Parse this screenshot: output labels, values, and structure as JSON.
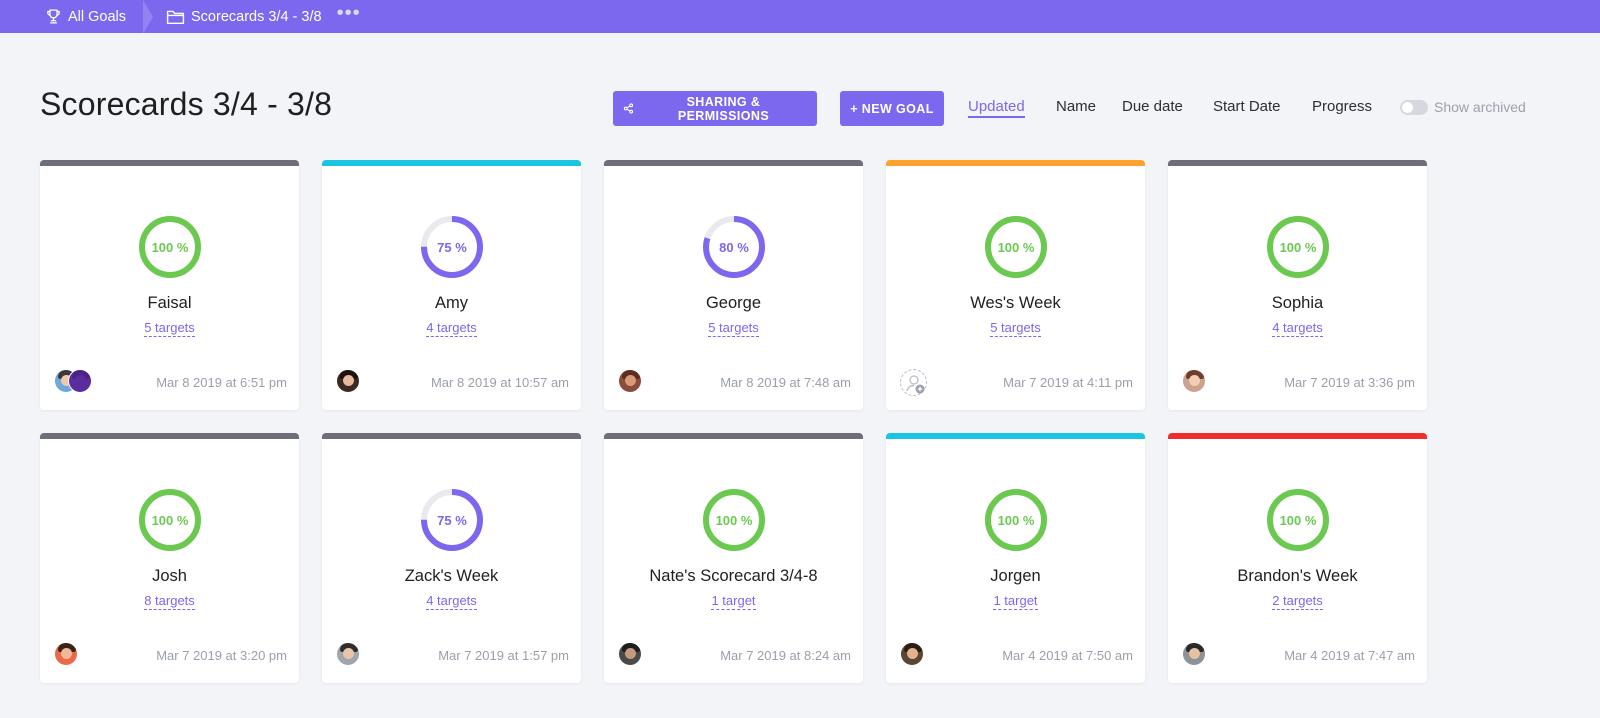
{
  "breadcrumb": {
    "all_goals": "All Goals",
    "folder": "Scorecards 3/4 - 3/8",
    "more": "•••"
  },
  "header": {
    "title": "Scorecards 3/4 - 3/8",
    "share_button": "SHARING & PERMISSIONS",
    "new_goal_button": "+ NEW GOAL",
    "sort_options": [
      "Updated",
      "Name",
      "Due date",
      "Start Date",
      "Progress"
    ],
    "active_sort": "Updated",
    "show_archived_label": "Show archived",
    "show_archived": false
  },
  "colors": {
    "brand": "#7b68ee",
    "complete": "#6bc950",
    "ring_track": "#e8eaed",
    "strip_gray": "#6d6e7a",
    "strip_cyan": "#1bc4e0",
    "strip_orange": "#ffa12f",
    "strip_red": "#f02d2d"
  },
  "cards": [
    {
      "name": "Faisal",
      "percent": 100,
      "percent_label": "100 %",
      "targets": "5 targets",
      "date": "Mar 8 2019 at 6:51 pm",
      "strip": "#6d6e7a"
    },
    {
      "name": "Amy",
      "percent": 75,
      "percent_label": "75 %",
      "targets": "4 targets",
      "date": "Mar 8 2019 at 10:57 am",
      "strip": "#1bc4e0"
    },
    {
      "name": "George",
      "percent": 80,
      "percent_label": "80 %",
      "targets": "5 targets",
      "date": "Mar 8 2019 at 7:48 am",
      "strip": "#6d6e7a"
    },
    {
      "name": "Wes's Week",
      "percent": 100,
      "percent_label": "100 %",
      "targets": "5 targets",
      "date": "Mar 7 2019 at 4:11 pm",
      "strip": "#ffa12f"
    },
    {
      "name": "Sophia",
      "percent": 100,
      "percent_label": "100 %",
      "targets": "4 targets",
      "date": "Mar 7 2019 at 3:36 pm",
      "strip": "#6d6e7a"
    },
    {
      "name": "Josh",
      "percent": 100,
      "percent_label": "100 %",
      "targets": "8 targets",
      "date": "Mar 7 2019 at 3:20 pm",
      "strip": "#6d6e7a"
    },
    {
      "name": "Zack's Week",
      "percent": 75,
      "percent_label": "75 %",
      "targets": "4 targets",
      "date": "Mar 7 2019 at 1:57 pm",
      "strip": "#6d6e7a"
    },
    {
      "name": "Nate's Scorecard 3/4-8",
      "percent": 100,
      "percent_label": "100 %",
      "targets": "1 target",
      "date": "Mar 7 2019 at 8:24 am",
      "strip": "#6d6e7a"
    },
    {
      "name": "Jorgen",
      "percent": 100,
      "percent_label": "100 %",
      "targets": "1 target",
      "date": "Mar 4 2019 at 7:50 am",
      "strip": "#1bc4e0"
    },
    {
      "name": "Brandon's Week",
      "percent": 100,
      "percent_label": "100 %",
      "targets": "2 targets",
      "date": "Mar 4 2019 at 7:47 am",
      "strip": "#f02d2d"
    }
  ]
}
